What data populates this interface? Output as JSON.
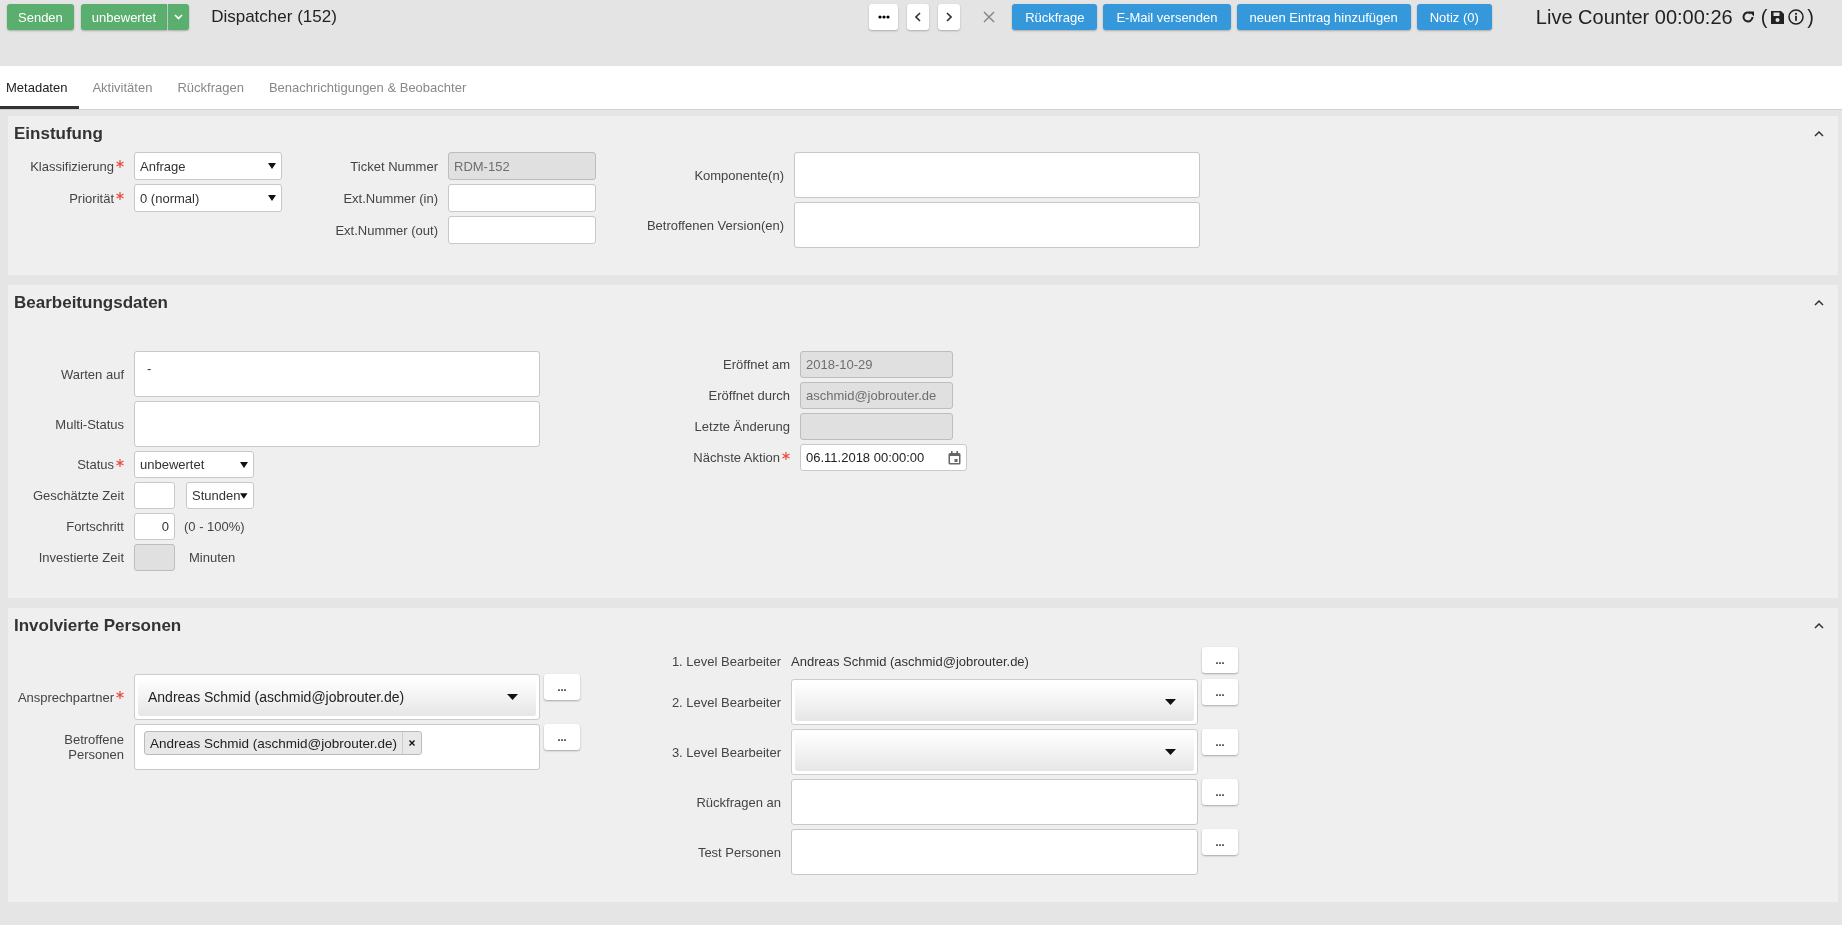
{
  "toolbar": {
    "buttons": [
      {
        "label": "Senden",
        "kind": "plain"
      },
      {
        "label": "unbewertet",
        "kind": "split"
      }
    ],
    "title": "Dispatcher (152)",
    "nav": [
      {
        "kind": "more"
      },
      {
        "kind": "prev"
      },
      {
        "kind": "next"
      },
      {
        "kind": "close"
      }
    ],
    "actions": [
      {
        "label": "Rückfrage"
      },
      {
        "label": "E-Mail versenden"
      },
      {
        "label": "neuen Eintrag hinzufügen"
      },
      {
        "label": "Notiz (0)"
      }
    ],
    "counter": {
      "label": "Live Counter 00:00:26",
      "open": "(",
      "close": ")"
    }
  },
  "tabs": [
    {
      "label": "Metadaten",
      "selected": true
    },
    {
      "label": "Aktivitäten",
      "selected": false
    },
    {
      "label": "Rückfragen",
      "selected": false
    },
    {
      "label": "Benachrichtigungen & Beobachter",
      "selected": false
    }
  ],
  "sections": [
    {
      "title": "Einstufung",
      "expanded": true,
      "columns": [
        [
          {
            "label": "Klassifizierung",
            "required": true,
            "kind": "select",
            "value": "Anfrage"
          },
          {
            "label": "Priorität",
            "required": true,
            "kind": "select",
            "value": "0 (normal)"
          }
        ],
        [
          {
            "label": "Ticket Nummer",
            "required": false,
            "kind": "readonly",
            "value": "RDM-152"
          },
          {
            "label": "Ext.Nummer (in)",
            "required": false,
            "kind": "text"
          },
          {
            "label": "Ext.Nummer (out)",
            "required": false,
            "kind": "text"
          }
        ],
        [
          {
            "label": "Komponente(n)",
            "required": false,
            "kind": "textarea"
          },
          {
            "label": "Betroffenen Version(en)",
            "required": false,
            "kind": "textarea"
          }
        ]
      ]
    },
    {
      "title": "Bearbeitungsdaten",
      "expanded": true,
      "columns": [
        [
          {
            "label": "Warten auf",
            "required": false,
            "kind": "textarea",
            "value": "-"
          },
          {
            "label": "Multi-Status",
            "required": false,
            "kind": "textarea"
          },
          {
            "label": "Status",
            "required": true,
            "kind": "select",
            "value": "unbewertet"
          },
          {
            "label": "Geschätzte Zeit",
            "required": false,
            "kind": "duration",
            "unit": "Stunden"
          },
          {
            "label": "Fortschritt",
            "required": false,
            "kind": "number",
            "value": "0",
            "note": "(0 - 100%)"
          },
          {
            "label": "Investierte Zeit",
            "required": false,
            "kind": "readonly_small",
            "note": "Minuten"
          }
        ],
        [
          {
            "label": "Eröffnet am",
            "required": false,
            "kind": "readonly",
            "value": "2018-10-29"
          },
          {
            "label": "Eröffnet durch",
            "required": false,
            "kind": "readonly",
            "value": "aschmid@jobrouter.de"
          },
          {
            "label": "Letzte Änderung",
            "required": false,
            "kind": "readonly"
          },
          {
            "label": "Nächste Aktion",
            "required": true,
            "kind": "date",
            "value": "06.11.2018 00:00:00"
          }
        ]
      ]
    },
    {
      "title": "Involvierte Personen",
      "expanded": true,
      "columns": [
        [
          {
            "label": "Ansprechpartner",
            "required": true,
            "kind": "combo",
            "value": "Andreas Schmid (aschmid@jobrouter.de)",
            "button": "..."
          },
          {
            "label": "Betroffene Personen",
            "required": false,
            "kind": "tags",
            "tags": [
              "Andreas Schmid (aschmid@jobrouter.de)"
            ],
            "button": "..."
          }
        ],
        [
          {
            "label": "1. Level Bearbeiter",
            "required": false,
            "kind": "plain",
            "value": "Andreas Schmid (aschmid@jobrouter.de)",
            "button": "..."
          },
          {
            "label": "2. Level Bearbeiter",
            "required": false,
            "kind": "combo",
            "button": "..."
          },
          {
            "label": "3. Level Bearbeiter",
            "required": false,
            "kind": "combo",
            "button": "..."
          },
          {
            "label": "Rückfragen an",
            "required": false,
            "kind": "textarea",
            "button": "..."
          },
          {
            "label": "Test Personen",
            "required": false,
            "kind": "textarea",
            "button": "..."
          }
        ]
      ]
    }
  ]
}
